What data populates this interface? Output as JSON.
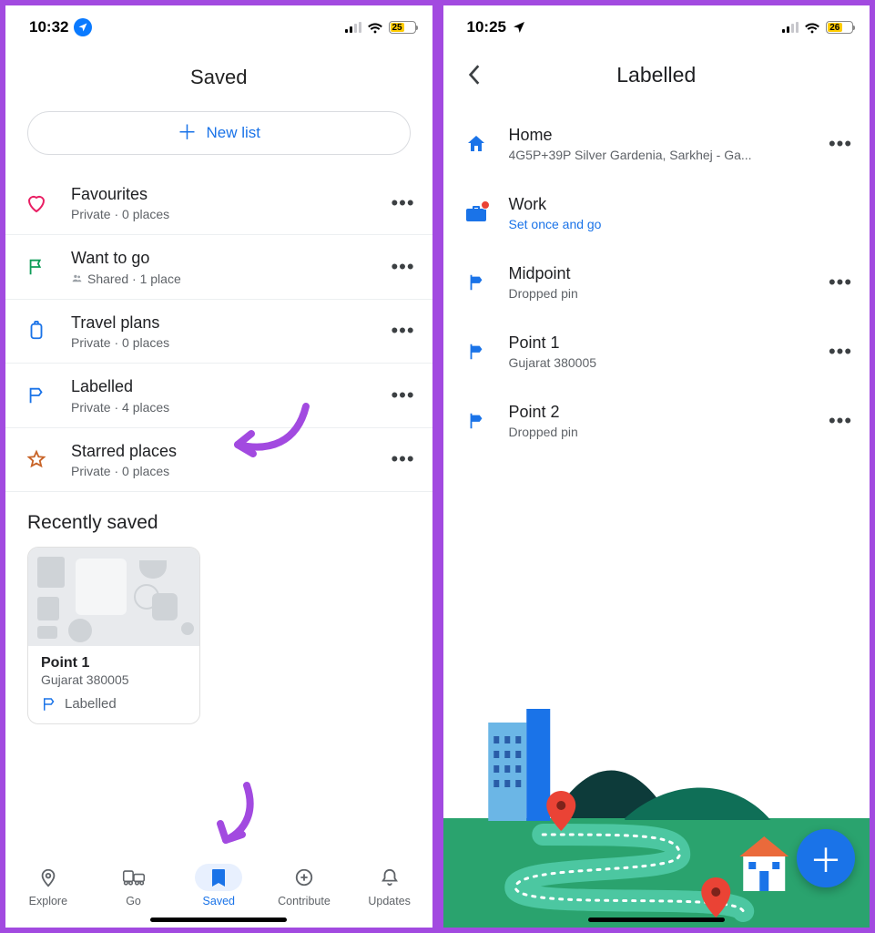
{
  "screen1": {
    "status": {
      "time": "10:32",
      "battery": "25"
    },
    "title": "Saved",
    "new_list": "New list",
    "lists": [
      {
        "id": "favourites",
        "title": "Favourites",
        "sub": "Private · 0 places"
      },
      {
        "id": "want-to-go",
        "title": "Want to go",
        "sub": "Shared · 1 place",
        "shared": true
      },
      {
        "id": "travel-plans",
        "title": "Travel plans",
        "sub": "Private · 0 places"
      },
      {
        "id": "labelled",
        "title": "Labelled",
        "sub": "Private · 4 places"
      },
      {
        "id": "starred",
        "title": "Starred places",
        "sub": "Private · 0 places"
      }
    ],
    "recent_header": "Recently saved",
    "recent_card": {
      "title": "Point 1",
      "sub": "Gujarat 380005",
      "tag": "Labelled"
    },
    "nav": {
      "explore": "Explore",
      "go": "Go",
      "saved": "Saved",
      "contribute": "Contribute",
      "updates": "Updates"
    }
  },
  "screen2": {
    "status": {
      "time": "10:25",
      "battery": "26"
    },
    "title": "Labelled",
    "items": [
      {
        "id": "home",
        "title": "Home",
        "sub": "4G5P+39P Silver Gardenia, Sarkhej - Ga..."
      },
      {
        "id": "work",
        "title": "Work",
        "sub": "Set once and go",
        "link": true
      },
      {
        "id": "midpoint",
        "title": "Midpoint",
        "sub": "Dropped pin"
      },
      {
        "id": "point1",
        "title": "Point 1",
        "sub": "Gujarat 380005"
      },
      {
        "id": "point2",
        "title": "Point 2",
        "sub": "Dropped pin"
      }
    ]
  }
}
